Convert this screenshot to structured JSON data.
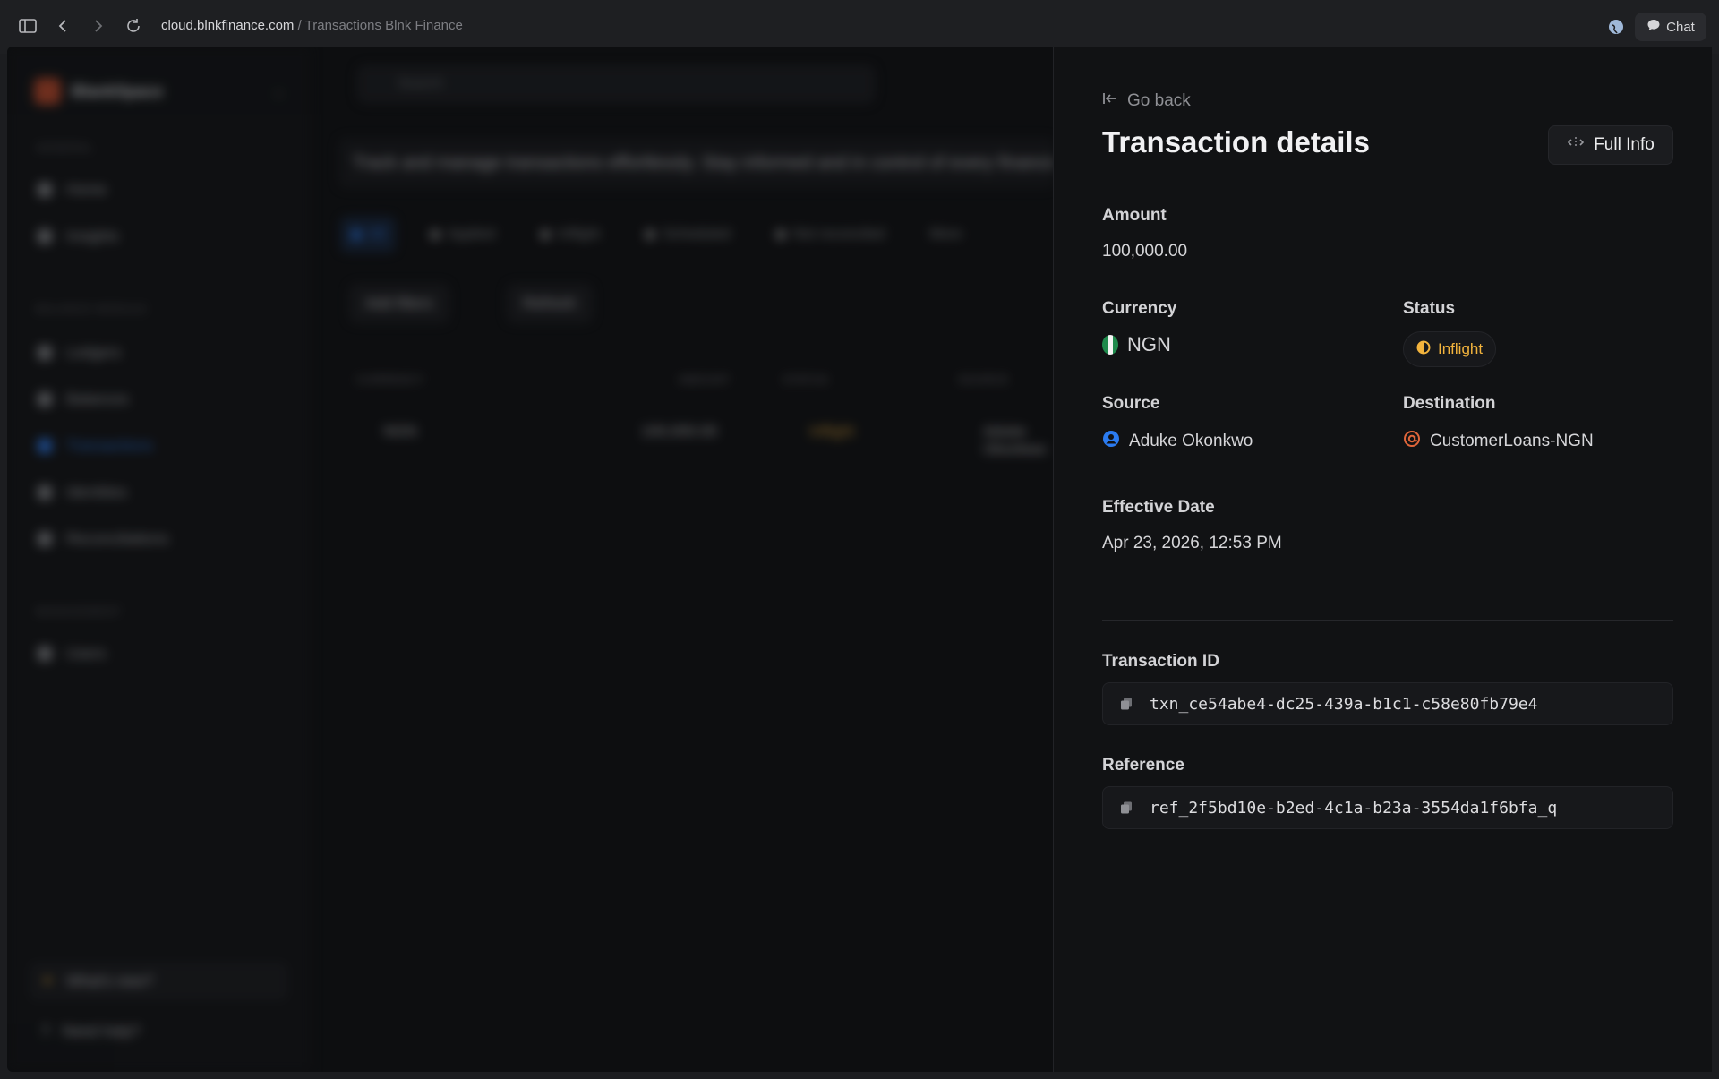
{
  "browser": {
    "domain": "cloud.blnkfinance.com",
    "path": " / Transactions Blnk Finance",
    "chat_label": "Chat"
  },
  "sidebar": {
    "workspace": "BlankSpace",
    "sections": [
      {
        "label": "GENERAL",
        "items": [
          "Home",
          "Insights"
        ]
      },
      {
        "label": "BALANCE MODULE",
        "items": [
          "Ledgers",
          "Balances",
          "Transactions",
          "Identities",
          "Reconciliations"
        ]
      },
      {
        "label": "MANAGEMENT",
        "items": [
          "Users"
        ]
      }
    ],
    "whats_new": "What's new?",
    "need_help": "Need help?"
  },
  "main": {
    "search_placeholder": "Search",
    "banner": "Track and manage transactions effortlessly. Stay informed and in control of every financial move.",
    "tabs": [
      "All",
      "Applied",
      "Inflight",
      "Scheduled",
      "Not reconciled",
      "More"
    ],
    "add_filters": "Add filters",
    "refresh": "Refresh",
    "columns": [
      "CURRENCY",
      "AMOUNT",
      "STATUS",
      "SOURCE"
    ],
    "row": {
      "currency": "NGN",
      "amount": "100,000.00",
      "status": "Inflight",
      "source": "Aduke Okonkwo"
    }
  },
  "panel": {
    "go_back": "Go back",
    "title": "Transaction details",
    "full_info": "Full Info",
    "amount_label": "Amount",
    "amount": "100,000.00",
    "currency_label": "Currency",
    "currency": "NGN",
    "status_label": "Status",
    "status": "Inflight",
    "source_label": "Source",
    "source": "Aduke Okonkwo",
    "destination_label": "Destination",
    "destination": "CustomerLoans-NGN",
    "effective_date_label": "Effective Date",
    "effective_date": "Apr 23, 2026, 12:53 PM",
    "transaction_id_label": "Transaction ID",
    "transaction_id": "txn_ce54abe4-dc25-439a-b1c1-c58e80fb79e4",
    "reference_label": "Reference",
    "reference": "ref_2f5bd10e-b2ed-4c1a-b23a-3554da1f6bfa_q"
  },
  "colors": {
    "accent": "#2b7bf0",
    "inflight": "#f2b33d",
    "destination_icon": "#e0653a",
    "source_icon": "#2b7bf0"
  }
}
